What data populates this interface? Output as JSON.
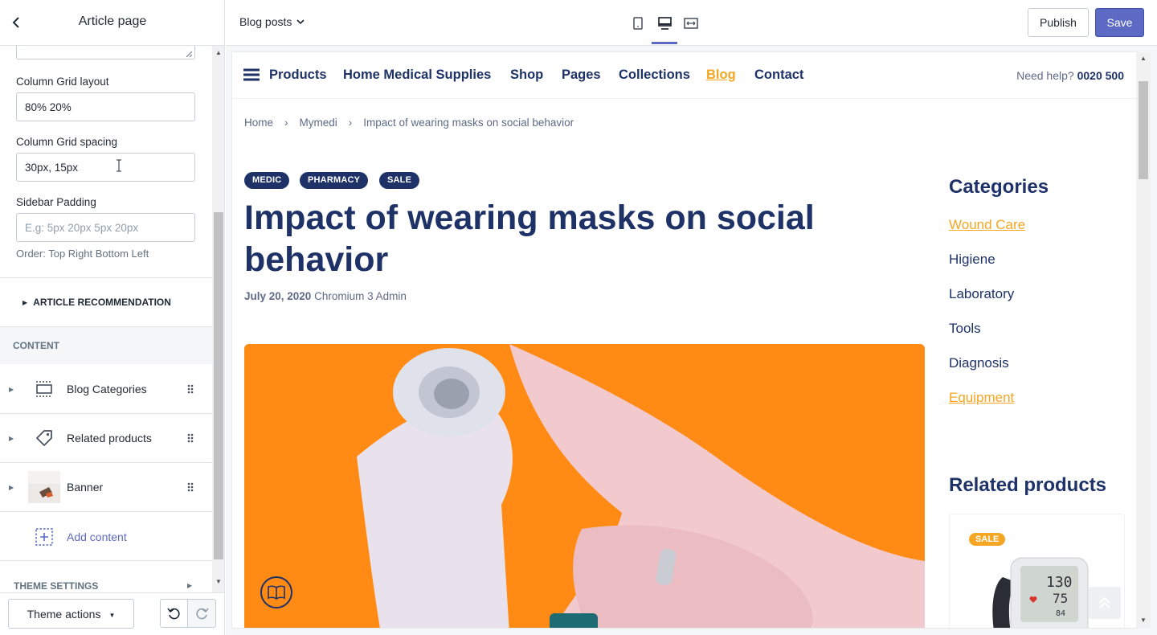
{
  "left_panel": {
    "title": "Article page",
    "fields": {
      "grid_layout_label": "Column Grid layout",
      "grid_layout_value": "80% 20%",
      "grid_spacing_label": "Column Grid spacing",
      "grid_spacing_value": "30px, 15px",
      "sidebar_padding_label": "Sidebar Padding",
      "sidebar_padding_placeholder": "E.g: 5px 20px 5px 20px",
      "sidebar_padding_help": "Order: Top Right Bottom Left"
    },
    "section_recommendation": "ARTICLE RECOMMENDATION",
    "content_header": "CONTENT",
    "content_items": [
      {
        "label": "Blog Categories",
        "icon": "section-icon"
      },
      {
        "label": "Related products",
        "icon": "tag-icon"
      },
      {
        "label": "Banner",
        "icon": "banner-thumbnail"
      }
    ],
    "add_content": "Add content",
    "theme_settings": "THEME SETTINGS",
    "footer": {
      "theme_actions": "Theme actions"
    }
  },
  "topbar": {
    "page_selector": "Blog posts",
    "device_active": "desktop",
    "publish": "Publish",
    "save": "Save",
    "accent": "#5c6ac4"
  },
  "preview": {
    "nav": [
      "Products",
      "Home Medical Supplies",
      "Shop",
      "Pages",
      "Collections",
      "Blog",
      "Contact"
    ],
    "nav_active": "Blog",
    "help_label": "Need help?",
    "help_phone": "0020 500",
    "breadcrumb": [
      "Home",
      "Mymedi",
      "Impact of wearing masks on social behavior"
    ],
    "tags": [
      "MEDIC",
      "PHARMACY",
      "SALE"
    ],
    "headline": "Impact of wearing masks on social behavior",
    "date": "July 20, 2020",
    "author": "Chromium 3 Admin",
    "categories_title": "Categories",
    "categories": [
      "Wound Care",
      "Higiene",
      "Laboratory",
      "Tools",
      "Diagnosis",
      "Equipment"
    ],
    "categories_highlighted": [
      "Wound Care",
      "Equipment"
    ],
    "related_title": "Related products",
    "sale_badge": "SALE",
    "colors": {
      "brand": "#1e3268",
      "accent": "#f5a623",
      "hero_bg": "#ff8a14"
    }
  }
}
